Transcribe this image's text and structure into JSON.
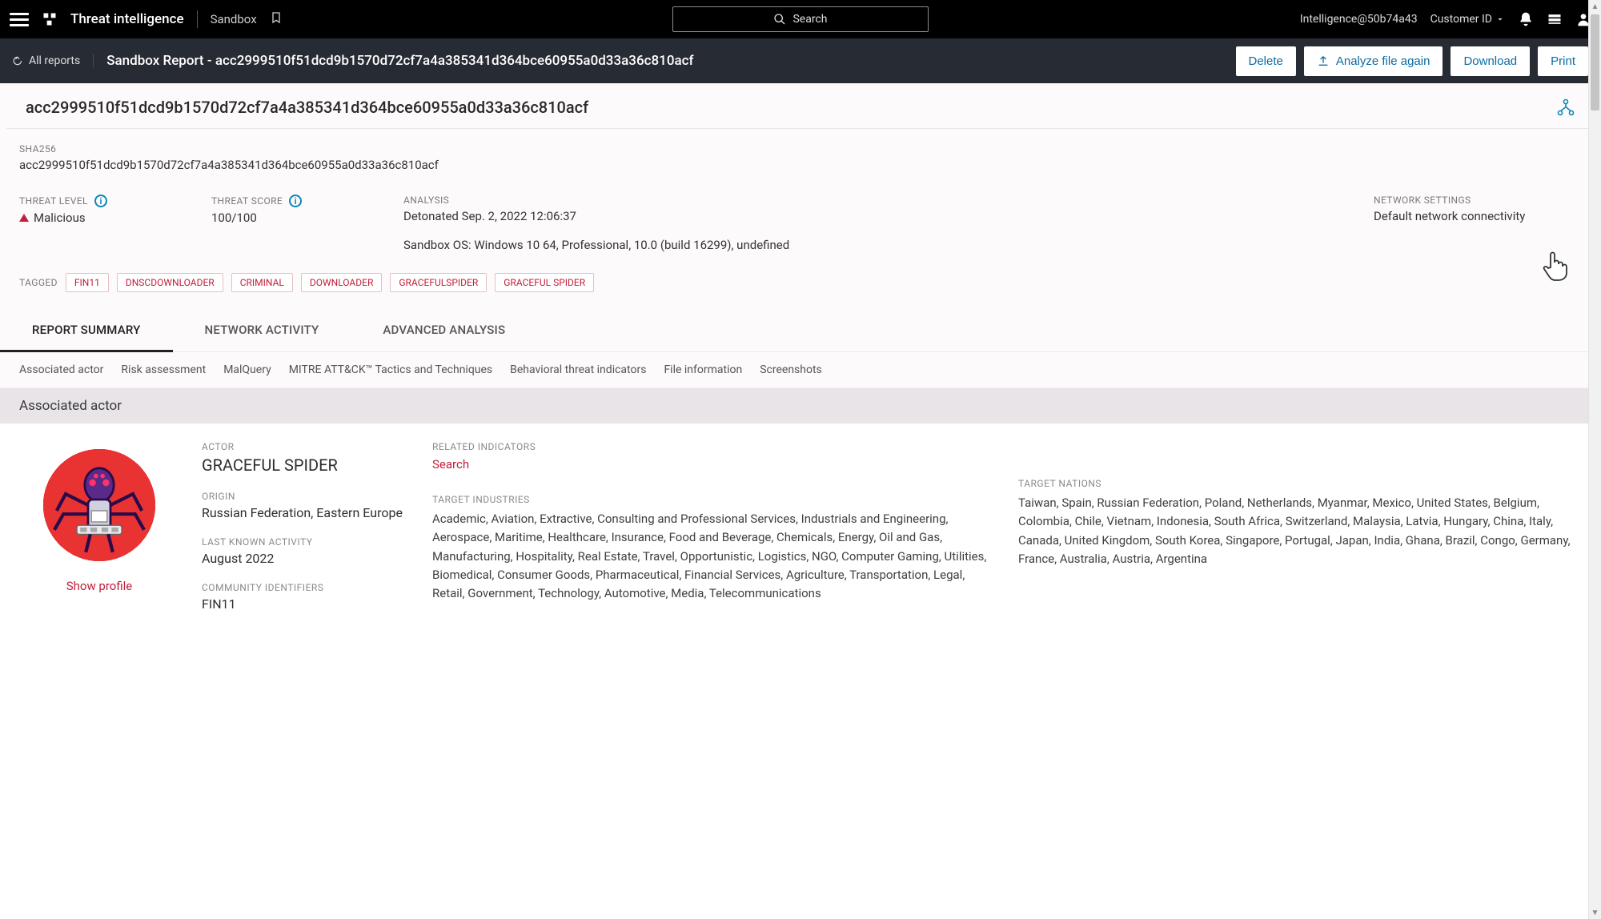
{
  "topbar": {
    "title": "Threat intelligence",
    "subtitle": "Sandbox",
    "search_placeholder": "Search",
    "intel_id": "Intelligence@50b74a43",
    "customer": "Customer ID"
  },
  "subbar": {
    "back": "All reports",
    "title": "Sandbox Report - acc2999510f51dcd9b1570d72cf7a4a385341d364bce60955a0d33a36c810acf",
    "delete": "Delete",
    "analyze": "Analyze file again",
    "download": "Download",
    "print": "Print"
  },
  "report": {
    "hash_title": "acc2999510f51dcd9b1570d72cf7a4a385341d364bce60955a0d33a36c810acf",
    "sha256_label": "SHA256",
    "sha256_value": "acc2999510f51dcd9b1570d72cf7a4a385341d364bce60955a0d33a36c810acf",
    "threat_level_label": "THREAT LEVEL",
    "threat_level_value": "Malicious",
    "threat_score_label": "THREAT SCORE",
    "threat_score_value": "100/100",
    "analysis_label": "ANALYSIS",
    "analysis_time": "Detonated Sep. 2, 2022 12:06:37",
    "analysis_os": "Sandbox OS: Windows 10 64, Professional, 10.0 (build 16299), undefined",
    "network_label": "NETWORK SETTINGS",
    "network_value": "Default network connectivity",
    "tagged_label": "TAGGED",
    "tags": [
      "FIN11",
      "DNSCDOWNLOADER",
      "CRIMINAL",
      "DOWNLOADER",
      "GRACEFULSPIDER",
      "GRACEFUL SPIDER"
    ]
  },
  "tabs": {
    "main": [
      "REPORT SUMMARY",
      "NETWORK ACTIVITY",
      "ADVANCED ANALYSIS"
    ],
    "sub": [
      "Associated actor",
      "Risk assessment",
      "MalQuery",
      "MITRE ATT&CK™ Tactics and Techniques",
      "Behavioral threat indicators",
      "File information",
      "Screenshots"
    ]
  },
  "section": {
    "header": "Associated actor",
    "show_profile": "Show profile",
    "actor_label": "ACTOR",
    "actor_name": "GRACEFUL SPIDER",
    "origin_label": "ORIGIN",
    "origin_value": "Russian Federation, Eastern Europe",
    "activity_label": "LAST KNOWN ACTIVITY",
    "activity_value": "August 2022",
    "community_label": "COMMUNITY IDENTIFIERS",
    "community_value": "FIN11",
    "indicators_label": "RELATED INDICATORS",
    "indicators_search": "Search",
    "industries_label": "TARGET INDUSTRIES",
    "industries_value": "Academic, Aviation, Extractive, Consulting and Professional Services, Industrials and Engineering, Aerospace, Maritime, Healthcare, Insurance, Food and Beverage, Chemicals, Energy, Oil and Gas, Manufacturing, Hospitality, Real Estate, Travel, Opportunistic, Logistics, NGO, Computer Gaming, Utilities, Biomedical, Consumer Goods, Pharmaceutical, Financial Services, Agriculture, Transportation, Legal, Retail, Government, Technology, Automotive, Media, Telecommunications",
    "nations_label": "TARGET NATIONS",
    "nations_value": "Taiwan, Spain, Russian Federation, Poland, Netherlands, Myanmar, Mexico, United States, Belgium, Colombia, Chile, Vietnam, Indonesia, South Africa, Switzerland, Malaysia, Latvia, Hungary, China, Italy, Canada, United Kingdom, South Korea, Singapore, Portugal, Japan, India, Ghana, Brazil, Congo, Germany, France, Australia, Austria, Argentina"
  }
}
